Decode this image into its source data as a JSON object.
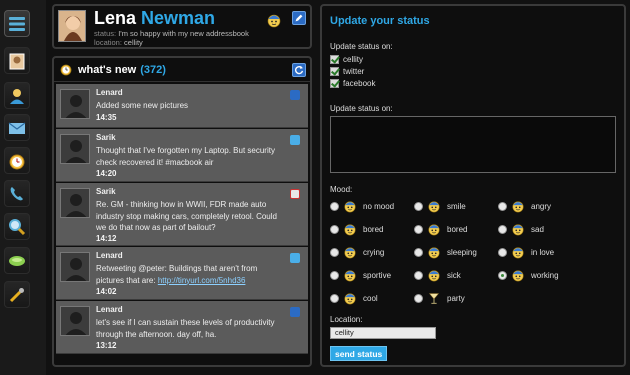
{
  "rail": {
    "items": [
      {
        "icon": "menu-icon"
      },
      {
        "icon": "contact-card-icon"
      },
      {
        "icon": "user-icon"
      },
      {
        "icon": "mail-icon"
      },
      {
        "icon": "timer-icon"
      },
      {
        "icon": "phone-icon"
      },
      {
        "icon": "search-icon"
      },
      {
        "icon": "chat-icon"
      },
      {
        "icon": "tools-icon"
      }
    ]
  },
  "profile": {
    "first_name": "Lena",
    "last_name": "Newman",
    "status_label": "status:",
    "status_text": "I'm so happy with my new addressbook",
    "location_label": "location:",
    "location_text": "cellity"
  },
  "feed": {
    "title": "what's new",
    "count": "(372)",
    "items": [
      {
        "author": "Lenard",
        "text": "Added some new pictures",
        "link": "",
        "time": "14:35",
        "source": "cellity"
      },
      {
        "author": "Sarik",
        "text": "Thought that I've forgotten my Laptop. But security check recovered it! #macbook air",
        "link": "",
        "time": "14:20",
        "source": "twitter"
      },
      {
        "author": "Sarik",
        "text": "Re. GM - thinking how in WWII, FDR made auto industry stop making cars, completely retool. Could we do that now as part of bailout?",
        "link": "",
        "time": "14:12",
        "source": "google"
      },
      {
        "author": "Lenard",
        "text": "Retweeting @peter: Buildings that aren't from pictures that are: ",
        "link": "http://tinyurl.com/5nhd36",
        "time": "14:02",
        "source": "twitter"
      },
      {
        "author": "Lenard",
        "text": "let's see if I can sustain these levels of productivity through the afternoon. day off, ha.",
        "link": "",
        "time": "13:12",
        "source": "cellity"
      }
    ]
  },
  "update": {
    "title": "Update your status",
    "status_on_label": "Update status on:",
    "networks": [
      "cellity",
      "twitter",
      "facebook"
    ],
    "status_on_label_2": "Update status on:",
    "mood_label": "Mood:",
    "moods": [
      "no mood",
      "smile",
      "angry",
      "bored",
      "bored",
      "sad",
      "crying",
      "sleeping",
      "in love",
      "sportive",
      "sick",
      "working",
      "cool",
      "party"
    ],
    "selected_mood": "working",
    "location_label": "Location:",
    "location_value": "cellity",
    "send_label": "send status"
  },
  "colors": {
    "accent": "#2fa8e6",
    "background": "#111111",
    "feed_item": "#5b5b5b"
  }
}
